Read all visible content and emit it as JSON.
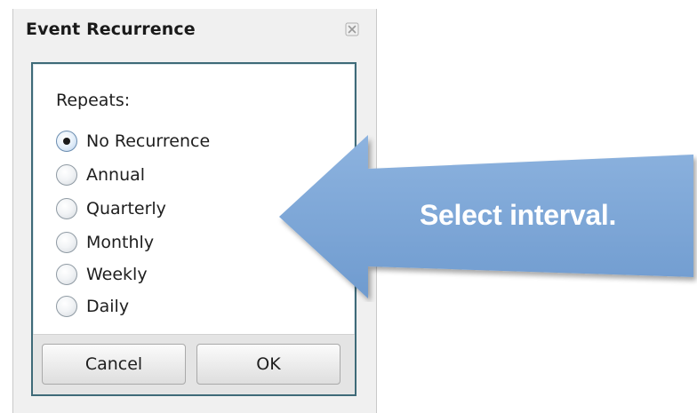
{
  "dialog": {
    "title": "Event Recurrence",
    "close_icon": "close-x-icon",
    "repeats_label": "Repeats:",
    "options": [
      {
        "label": "No Recurrence",
        "checked": true
      },
      {
        "label": "Annual",
        "checked": false
      },
      {
        "label": "Quarterly",
        "checked": false
      },
      {
        "label": "Monthly",
        "checked": false
      },
      {
        "label": "Weekly",
        "checked": false
      },
      {
        "label": "Daily",
        "checked": false
      }
    ],
    "buttons": {
      "cancel_label": "Cancel",
      "ok_label": "OK"
    }
  },
  "callout": {
    "text": "Select interval.",
    "icon": "left-arrow-callout",
    "color": "#7aa6d6"
  },
  "colors": {
    "panel_border": "#3e6a78",
    "dialog_background": "#f0f0f0"
  }
}
